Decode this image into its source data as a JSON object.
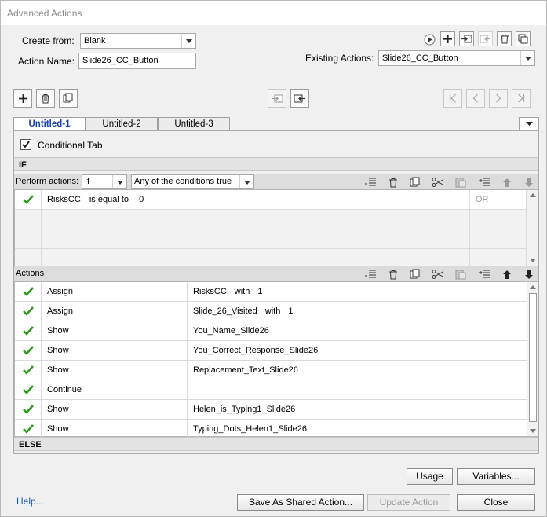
{
  "window": {
    "title": "Advanced Actions"
  },
  "header": {
    "create_from_label": "Create from:",
    "create_from_value": "Blank",
    "action_name_label": "Action Name:",
    "action_name_value": "Slide26_CC_Button",
    "existing_actions_label": "Existing Actions:",
    "existing_actions_value": "Slide26_CC_Button"
  },
  "tabs": [
    {
      "label": "Untitled-1",
      "active": true
    },
    {
      "label": "Untitled-2",
      "active": false
    },
    {
      "label": "Untitled-3",
      "active": false
    }
  ],
  "conditional_tab": {
    "label": "Conditional Tab",
    "checked": true
  },
  "if_section": {
    "label": "IF"
  },
  "perform_actions": {
    "label": "Perform actions:",
    "type_value": "If",
    "condition_mode_value": "Any of the conditions true"
  },
  "conditions": [
    {
      "variable": "RisksCC",
      "operator": "is equal to",
      "value": "0",
      "logic": "OR"
    }
  ],
  "actions_section": {
    "label": "Actions"
  },
  "actions": [
    {
      "command": "Assign",
      "target": "RisksCC",
      "with_label": "with",
      "with_value": "1"
    },
    {
      "command": "Assign",
      "target": "Slide_26_Visited",
      "with_label": "with",
      "with_value": "1"
    },
    {
      "command": "Show",
      "target": "You_Name_Slide26",
      "with_label": "",
      "with_value": ""
    },
    {
      "command": "Show",
      "target": "You_Correct_Response_Slide26",
      "with_label": "",
      "with_value": ""
    },
    {
      "command": "Show",
      "target": "Replacement_Text_Slide26",
      "with_label": "",
      "with_value": ""
    },
    {
      "command": "Continue",
      "target": "",
      "with_label": "",
      "with_value": ""
    },
    {
      "command": "Show",
      "target": "Helen_is_Typing1_Slide26",
      "with_label": "",
      "with_value": ""
    },
    {
      "command": "Show",
      "target": "Typing_Dots_Helen1_Slide26",
      "with_label": "",
      "with_value": ""
    }
  ],
  "else_section": {
    "label": "ELSE"
  },
  "footer": {
    "usage_label": "Usage",
    "variables_label": "Variables...",
    "help_label": "Help...",
    "save_shared_label": "Save As Shared Action...",
    "update_label": "Update Action",
    "close_label": "Close"
  },
  "colors": {
    "check": "#2e9a1d",
    "link": "#1a5fc0",
    "active_tab": "#1a3fb0"
  },
  "icons": [
    "play-icon",
    "plus-icon",
    "import-icon",
    "export-icon",
    "trash-icon",
    "duplicate-icon",
    "check-icon",
    "scissors-icon",
    "paste-icon",
    "insert-icon",
    "arrow-up-icon",
    "arrow-down-icon",
    "first-icon",
    "prev-icon",
    "next-icon",
    "last-icon"
  ]
}
